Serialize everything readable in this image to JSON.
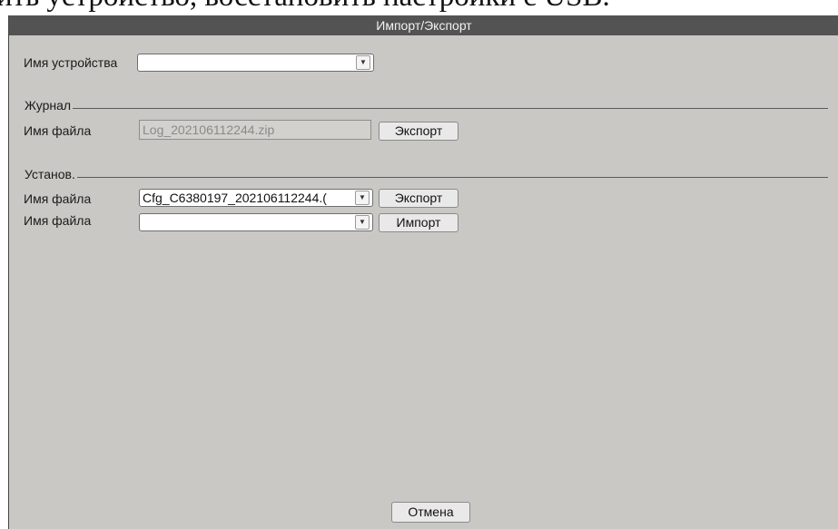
{
  "background_text": "ить устройство, восстановить настройки с USB.",
  "dialog": {
    "title": "Импорт/Экспорт",
    "device": {
      "label": "Имя устройства",
      "value": ""
    },
    "log_section": {
      "title": "Журнал",
      "file_label": "Имя файла",
      "file_value": "Log_202106112244.zip",
      "export_button": "Экспорт"
    },
    "config_section": {
      "title": "Установ.",
      "export_file_label": "Имя файла",
      "export_file_value": "Cfg_C6380197_202106112244.(",
      "export_button": "Экспорт",
      "import_file_label": "Имя файла",
      "import_file_value": "",
      "import_button": "Импорт"
    },
    "cancel_button": "Отмена"
  },
  "icons": {
    "dropdown_arrow": "chevron-down-icon"
  },
  "colors": {
    "window_bg": "#c9c8c4",
    "titlebar_bg": "#535353",
    "titlebar_text": "#f2f2f2"
  }
}
